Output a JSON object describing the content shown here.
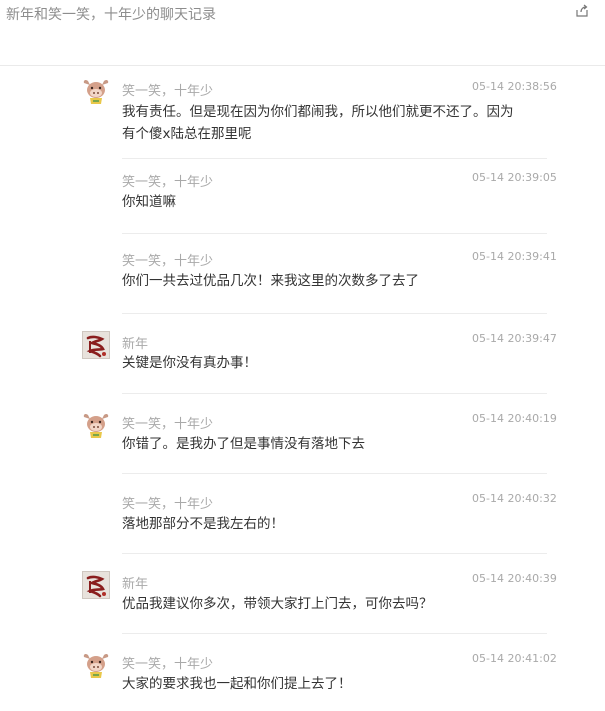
{
  "header": {
    "title": "新年和笑一笑，十年少的聊天记录",
    "share_icon": "share-icon"
  },
  "messages": [
    {
      "sender": "笑一笑，十年少",
      "time": "05-14 20:38:56",
      "avatar": "cow",
      "text": "我有责任。但是现在因为你们都闹我，所以他们就更不还了。因为有个傻x陆总在那里呢"
    },
    {
      "sender": "笑一笑，十年少",
      "time": "05-14 20:39:05",
      "avatar": "",
      "text": "你知道嘛"
    },
    {
      "sender": "笑一笑，十年少",
      "time": "05-14 20:39:41",
      "avatar": "",
      "text": "你们一共去过优品几次！来我这里的次数多了去了"
    },
    {
      "sender": "新年",
      "time": "05-14 20:39:47",
      "avatar": "calligraphy",
      "text": "关键是你没有真办事！"
    },
    {
      "sender": "笑一笑，十年少",
      "time": "05-14 20:40:19",
      "avatar": "cow",
      "text": "你错了。是我办了但是事情没有落地下去"
    },
    {
      "sender": "笑一笑，十年少",
      "time": "05-14 20:40:32",
      "avatar": "",
      "text": "落地那部分不是我左右的！"
    },
    {
      "sender": "新年",
      "time": "05-14 20:40:39",
      "avatar": "calligraphy",
      "text": "优品我建议你多次，带领大家打上门去，可你去吗？"
    },
    {
      "sender": "笑一笑，十年少",
      "time": "05-14 20:41:02",
      "avatar": "cow",
      "text": "大家的要求我也一起和你们提上去了！"
    }
  ]
}
